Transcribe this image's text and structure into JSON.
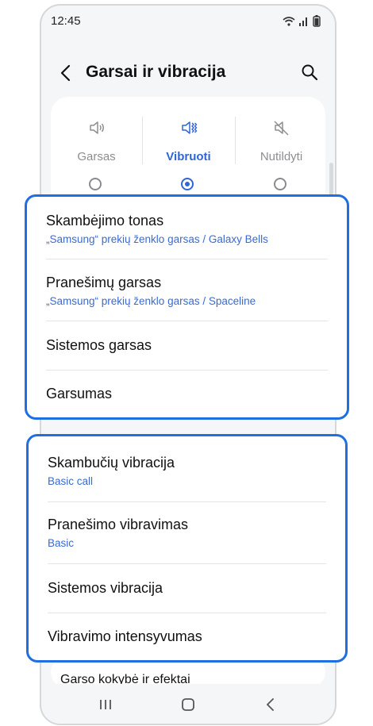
{
  "status_bar": {
    "time": "12:45"
  },
  "header": {
    "title": "Garsai ir vibracija"
  },
  "modes": [
    {
      "label": "Garsas",
      "icon": "speaker-icon",
      "selected": false
    },
    {
      "label": "Vibruoti",
      "icon": "vibrate-icon",
      "selected": true
    },
    {
      "label": "Nutildyti",
      "icon": "mute-icon",
      "selected": false
    }
  ],
  "sound_settings": [
    {
      "title": "Skambėjimo tonas",
      "subtitle": "„Samsung“ prekių ženklo garsas / Galaxy Bells"
    },
    {
      "title": "Pranešimų garsas",
      "subtitle": "„Samsung“ prekių ženklo garsas / Spaceline"
    },
    {
      "title": "Sistemos garsas"
    },
    {
      "title": "Garsumas"
    }
  ],
  "vibration_settings": [
    {
      "title": "Skambučių vibracija",
      "subtitle": "Basic call"
    },
    {
      "title": "Pranešimo vibravimas",
      "subtitle": "Basic"
    },
    {
      "title": "Sistemos vibracija"
    },
    {
      "title": "Vibravimo intensyvumas"
    }
  ],
  "more_item": {
    "title": "Garso kokybė ir efektai"
  },
  "colors": {
    "accent": "#3165d6",
    "highlight": "#1f6fe0"
  }
}
